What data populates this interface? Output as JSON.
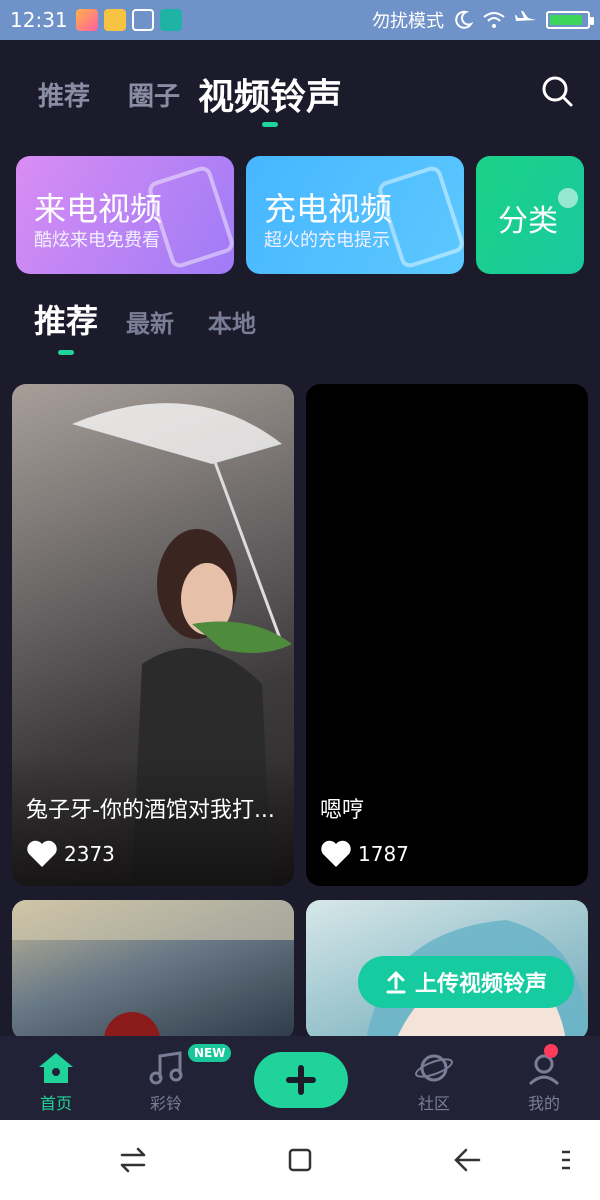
{
  "status_bar": {
    "time": "12:31",
    "dnd_label": "勿扰模式",
    "battery_level": 0.9
  },
  "top_tabs": {
    "items": [
      "推荐",
      "圈子",
      "视频铃声"
    ],
    "active_index": 2
  },
  "banners": [
    {
      "title": "来电视频",
      "subtitle": "酷炫来电免费看",
      "color_start": "#d98df3",
      "color_end": "#9f7bf6"
    },
    {
      "title": "充电视频",
      "subtitle": "超火的充电提示",
      "color_start": "#47b6ff",
      "color_end": "#5cc8ff"
    },
    {
      "title": "分类",
      "subtitle": "",
      "color_start": "#1bd286",
      "color_end": "#19c9a0"
    }
  ],
  "sub_tabs": {
    "items": [
      "推荐",
      "最新",
      "本地"
    ],
    "active_index": 0
  },
  "cards": [
    {
      "caption": "兔子牙-你的酒馆对我打...",
      "likes": "2373"
    },
    {
      "caption": "嗯哼",
      "likes": "1787"
    },
    {
      "caption": "",
      "likes": ""
    },
    {
      "caption": "",
      "likes": ""
    }
  ],
  "upload_button": {
    "label": "上传视频铃声"
  },
  "bottom_nav": {
    "home": "首页",
    "ringtone": "彩铃",
    "new_badge": "NEW",
    "community": "社区",
    "mine": "我的"
  },
  "colors": {
    "accent": "#1fd39a",
    "background": "#1b1b2b",
    "tab_inactive": "#8a8da3"
  }
}
